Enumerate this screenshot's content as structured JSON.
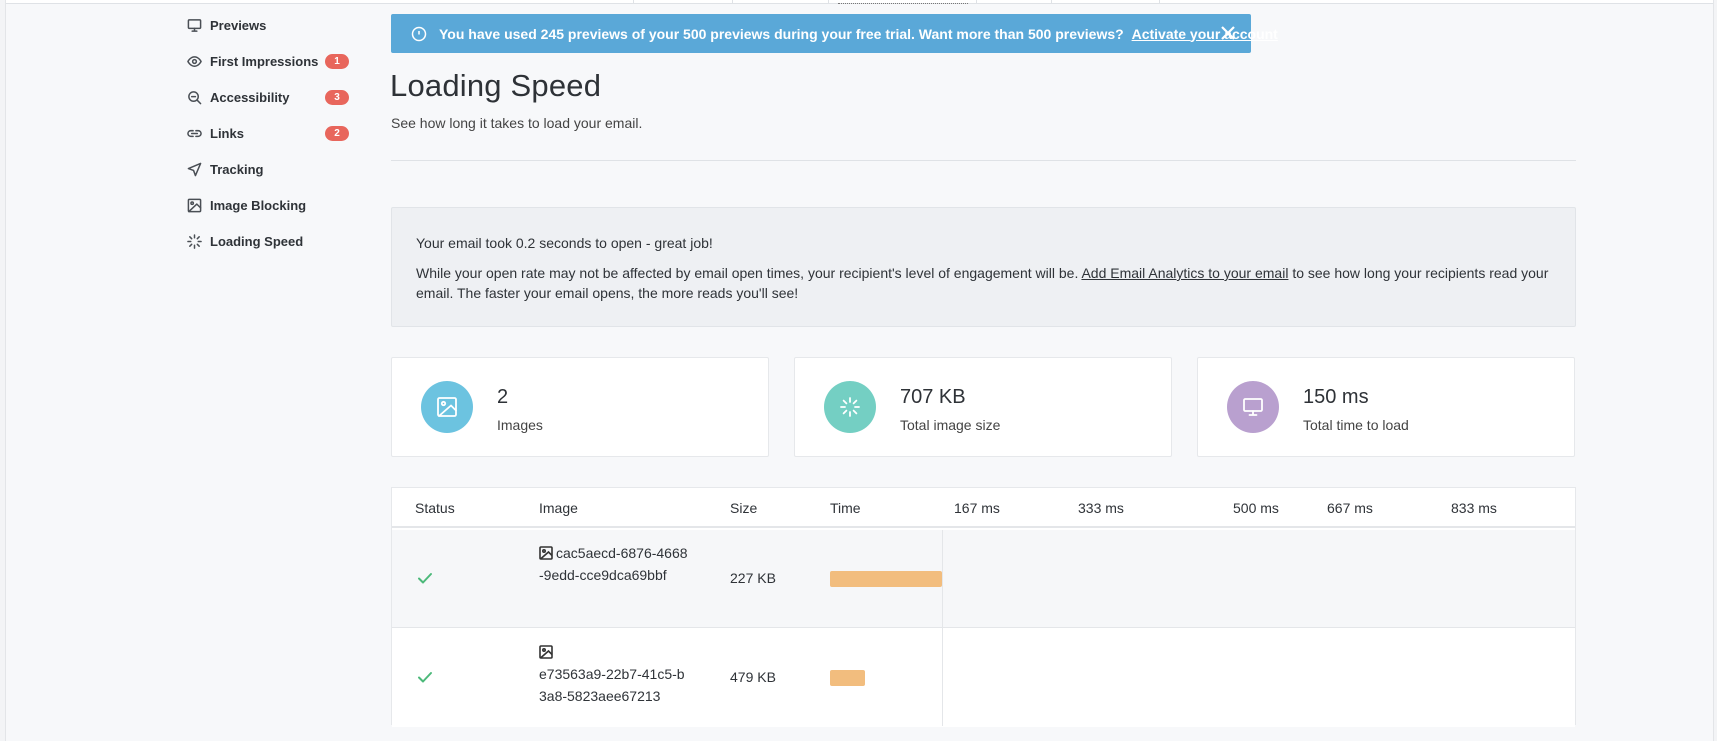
{
  "sidebar": {
    "items": [
      {
        "label": "Previews",
        "icon": "monitor-icon",
        "badge": ""
      },
      {
        "label": "First Impressions",
        "icon": "eye-icon",
        "badge": "1"
      },
      {
        "label": "Accessibility",
        "icon": "magnifier-icon",
        "badge": "3"
      },
      {
        "label": "Links",
        "icon": "link-icon",
        "badge": "2"
      },
      {
        "label": "Tracking",
        "icon": "send-icon",
        "badge": ""
      },
      {
        "label": "Image Blocking",
        "icon": "image-icon",
        "badge": ""
      },
      {
        "label": "Loading Speed",
        "icon": "spinner-icon",
        "badge": ""
      }
    ]
  },
  "banner": {
    "message": "You have used 245 previews of your 500 previews during your free trial. Want more than 500 previews?",
    "link": "Activate your account"
  },
  "page": {
    "title": "Loading Speed",
    "subtitle": "See how long it takes to load your email."
  },
  "summary": {
    "line1": "Your email took 0.2 seconds to open - great job!",
    "line2_before": "While your open rate may not be affected by email open times, your recipient's level of engagement will be. ",
    "line2_link": "Add Email Analytics to your email",
    "line2_after": " to see how long your recipients read your email. The faster your email opens, the more reads you'll see!"
  },
  "stats": [
    {
      "value": "2",
      "label": "Images",
      "icon": "image-icon",
      "color": "#6cc3e0"
    },
    {
      "value": "707 KB",
      "label": "Total image size",
      "icon": "spinner-icon",
      "color": "#74cfc3"
    },
    {
      "value": "150 ms",
      "label": "Total time to load",
      "icon": "monitor-icon",
      "color": "#b9a0cf"
    }
  ],
  "table": {
    "headers": {
      "status": "Status",
      "image": "Image",
      "size": "Size",
      "time": "Time",
      "ticks": [
        "167 ms",
        "333 ms",
        "500 ms",
        "667 ms",
        "833 ms"
      ]
    },
    "rows": [
      {
        "status": "ok",
        "image": "cac5aecd-6876-4668-9edd-cce9dca69bbf",
        "size": "227 KB"
      },
      {
        "status": "ok",
        "image": "e73563a9-22b7-41c5-b3a8-5823aee67213",
        "size": "479 KB"
      }
    ]
  },
  "colors": {
    "banner": "#5aa8d8",
    "badge": "#e8665c",
    "bar": "#f2bd7e",
    "check": "#4cb97a"
  }
}
